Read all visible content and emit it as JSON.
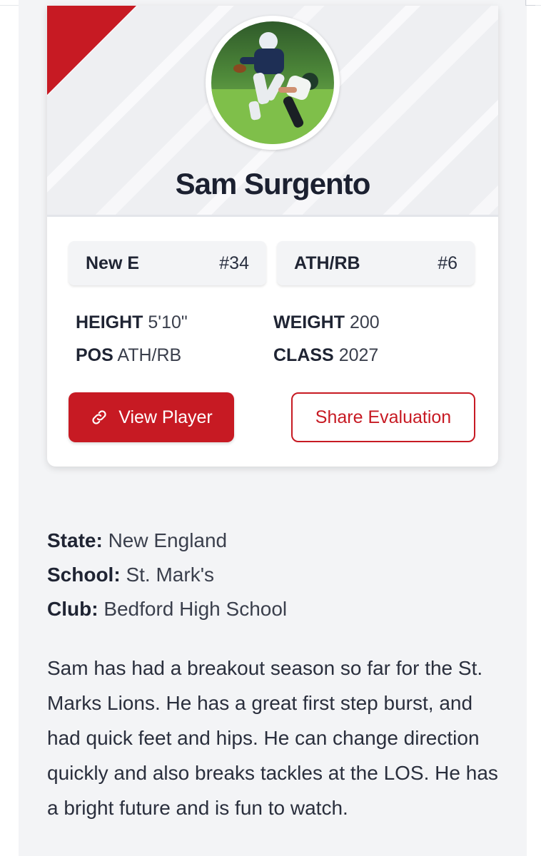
{
  "player": {
    "name": "Sam Surgento",
    "avatar_icon": "player-photo"
  },
  "chips": {
    "team_label": "New E",
    "team_number": "#34",
    "position_label": "ATH/RB",
    "position_rank": "#6"
  },
  "stats": {
    "height_key": "HEIGHT",
    "height_value": "5'10\"",
    "weight_key": "WEIGHT",
    "weight_value": "200",
    "pos_key": "POS",
    "pos_value": "ATH/RB",
    "class_key": "CLASS",
    "class_value": "2027"
  },
  "actions": {
    "view_label": "View Player",
    "share_label": "Share Evaluation"
  },
  "details": {
    "state_key": "State:",
    "state_value": "New England",
    "school_key": "School:",
    "school_value": "St. Mark's",
    "club_key": "Club:",
    "club_value": "Bedford High School"
  },
  "bio": "Sam has had a breakout season so far for the St. Marks Lions. He has a great first step burst, and had quick feet and hips. He can change direction quickly and also breaks tackles at the LOS. He has a bright future and is fun to watch.",
  "colors": {
    "accent": "#c71a23",
    "panel": "#f3f4f6"
  }
}
